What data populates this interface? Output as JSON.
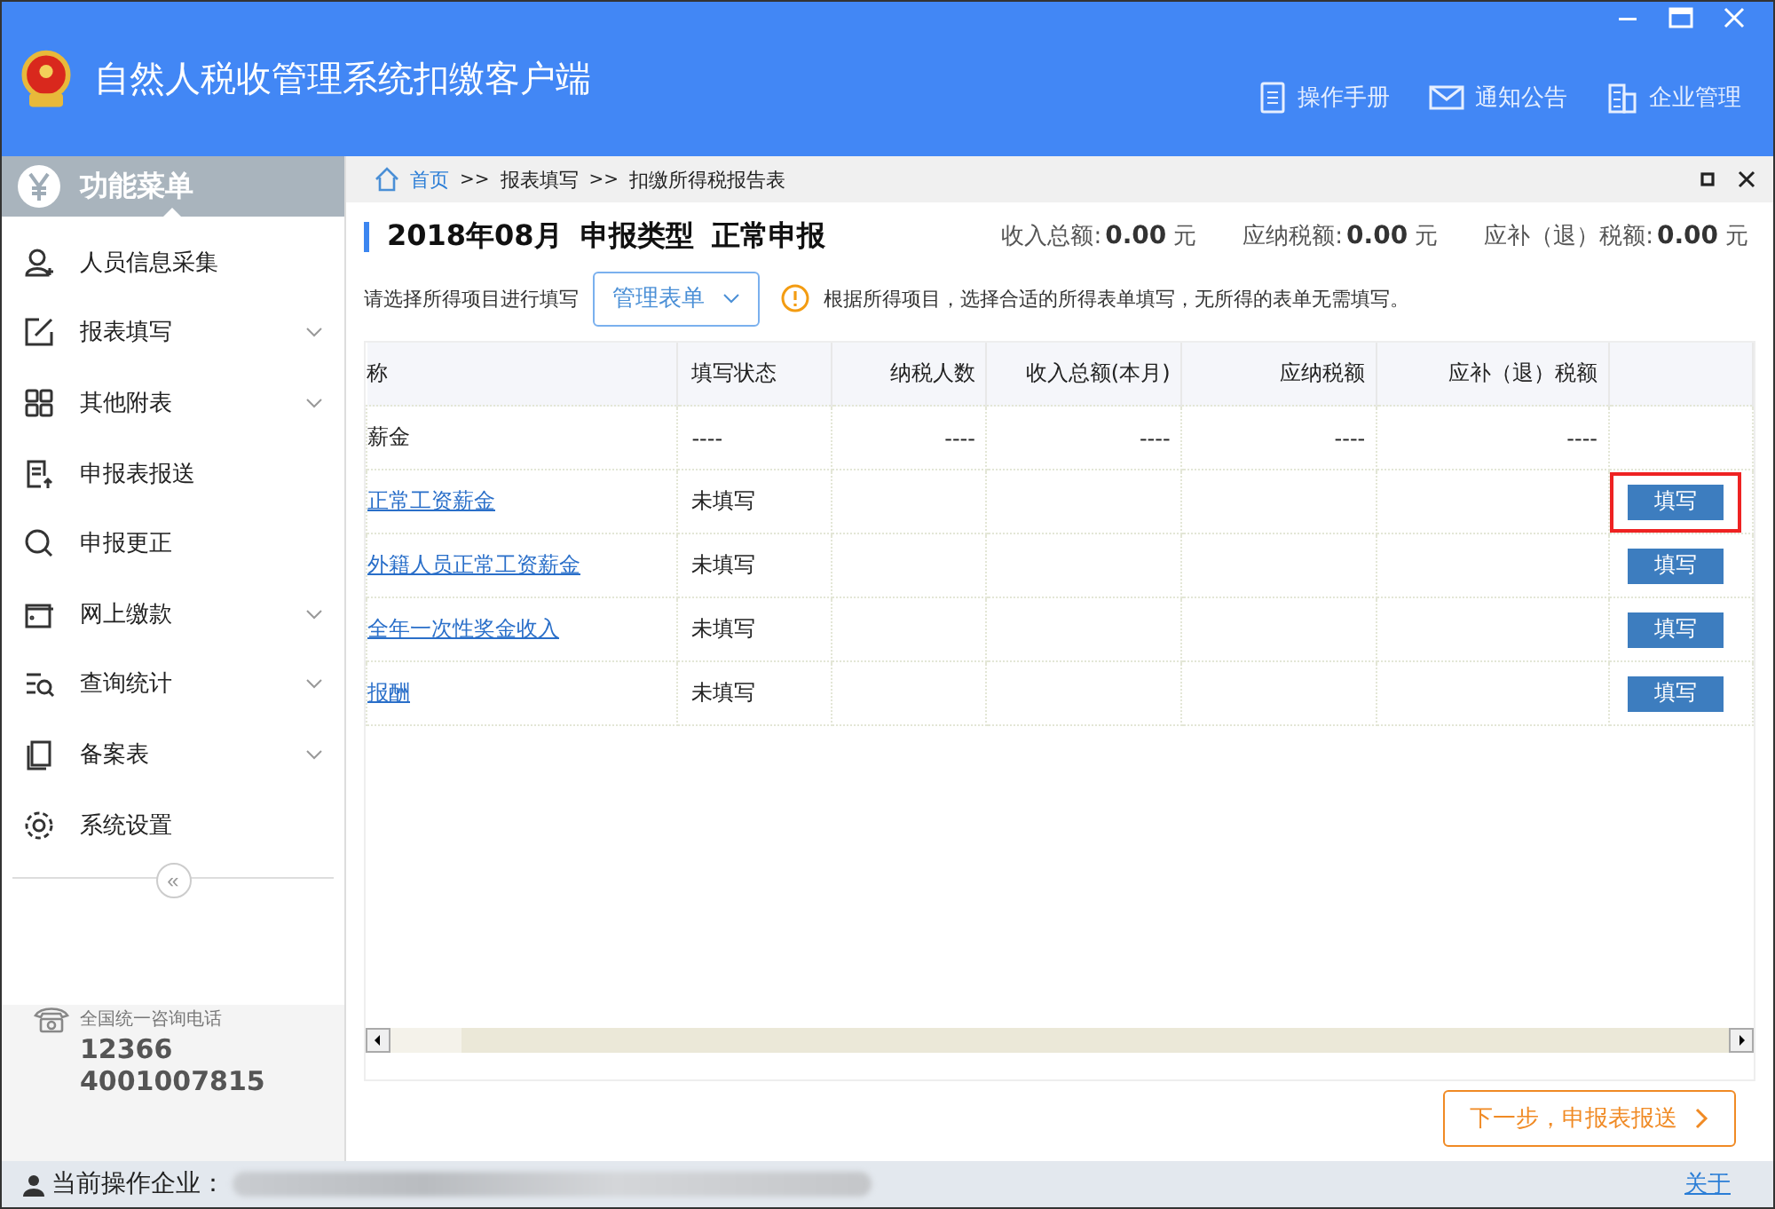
{
  "window": {
    "title": "自然人税收管理系统扣缴客户端"
  },
  "header_links": [
    "操作手册",
    "通知公告",
    "企业管理"
  ],
  "sidebar": {
    "title": "功能菜单",
    "items": [
      {
        "label": "人员信息采集",
        "expandable": false
      },
      {
        "label": "报表填写",
        "expandable": true
      },
      {
        "label": "其他附表",
        "expandable": true
      },
      {
        "label": "申报表报送",
        "expandable": false
      },
      {
        "label": "申报更正",
        "expandable": false
      },
      {
        "label": "网上缴款",
        "expandable": true
      },
      {
        "label": "查询统计",
        "expandable": true
      },
      {
        "label": "备案表",
        "expandable": true
      },
      {
        "label": "系统设置",
        "expandable": false
      }
    ],
    "collapse": "«",
    "hotline_label": "全国统一咨询电话",
    "hotlines": [
      "12366",
      "4001007815"
    ]
  },
  "breadcrumb": [
    "首页",
    ">>",
    "报表填写",
    ">>",
    "扣缴所得税报告表"
  ],
  "summary": {
    "period": "2018年08月",
    "type_label": "申报类型",
    "type": "正常申报",
    "totals": [
      {
        "label": "收入总额:",
        "value": "0.00",
        "unit": "元"
      },
      {
        "label": "应纳税额:",
        "value": "0.00",
        "unit": "元"
      },
      {
        "label": "应补（退）税额:",
        "value": "0.00",
        "unit": "元"
      }
    ]
  },
  "filter": {
    "label": "请选择所得项目进行填写",
    "dropdown": "管理表单",
    "notice": "根据所得项目，选择合适的所得表单填写，无所得的表单无需填写。"
  },
  "table": {
    "columns": [
      "称",
      "填写状态",
      "纳税人数",
      "收入总额(本月)",
      "应纳税额",
      "应补（退）税额"
    ],
    "rows": [
      {
        "cells": [
          "薪金",
          "----",
          "----",
          "----",
          "----",
          "----"
        ],
        "link": false,
        "highlighted": false
      },
      {
        "cells": [
          "正常工资薪金",
          "未填写",
          "",
          "",
          "",
          ""
        ],
        "link": true,
        "button": "填写",
        "highlighted": true
      },
      {
        "cells": [
          "外籍人员正常工资薪金",
          "未填写",
          "",
          "",
          "",
          ""
        ],
        "link": true,
        "button": "填写",
        "highlighted": false
      },
      {
        "cells": [
          "全年一次性奖金收入",
          "未填写",
          "",
          "",
          "",
          ""
        ],
        "link": true,
        "button": "填写",
        "highlighted": false
      },
      {
        "cells": [
          "报酬",
          "未填写",
          "",
          "",
          "",
          ""
        ],
        "link": true,
        "button": "填写",
        "highlighted": false
      }
    ]
  },
  "next_button": "下一步，申报表报送",
  "status_bar": {
    "label": "当前操作企业：",
    "about": "关于"
  }
}
